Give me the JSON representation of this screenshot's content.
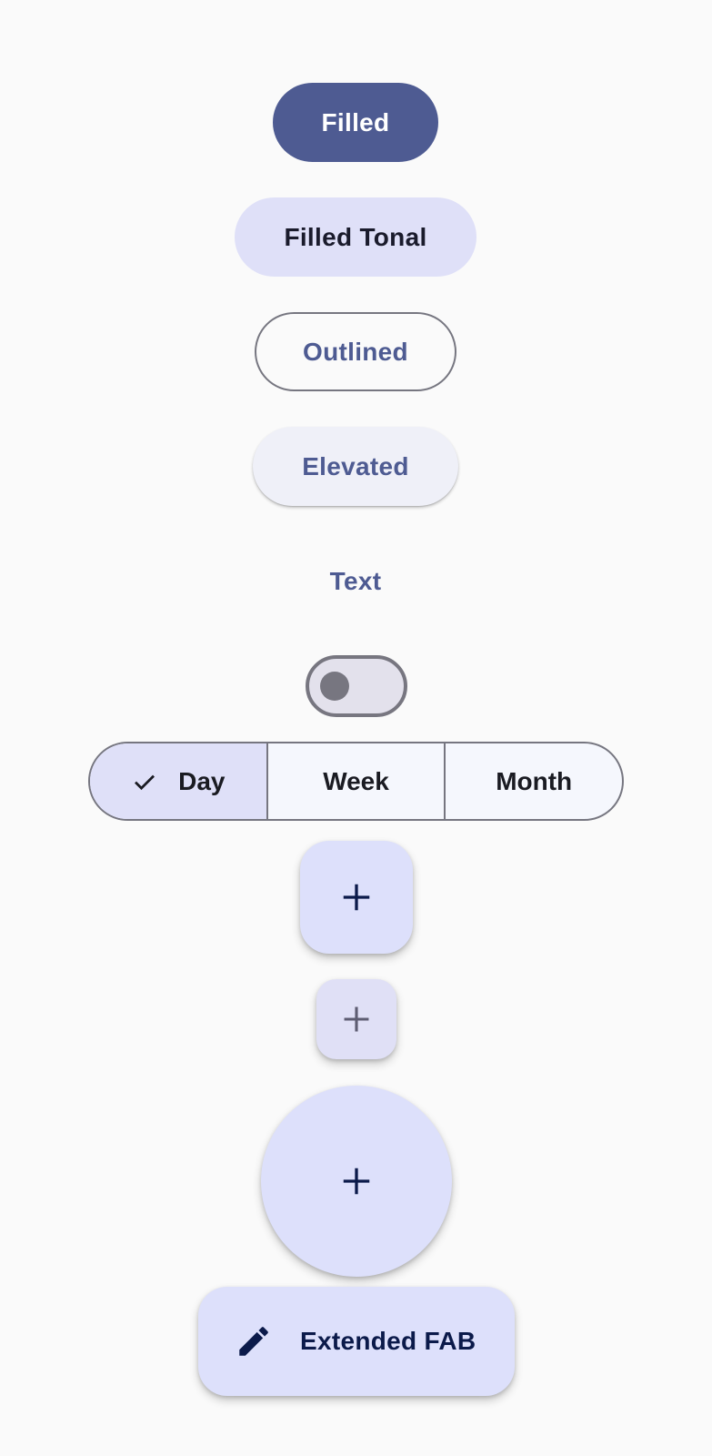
{
  "buttons": {
    "filled": "Filled",
    "filled_tonal": "Filled Tonal",
    "outlined": "Outlined",
    "elevated": "Elevated",
    "text": "Text"
  },
  "switch": {
    "checked": false
  },
  "segmented": {
    "options": [
      {
        "label": "Day",
        "selected": true,
        "icon": "check-icon"
      },
      {
        "label": "Week",
        "selected": false
      },
      {
        "label": "Month",
        "selected": false
      }
    ]
  },
  "fabs": {
    "regular_icon": "add-icon",
    "small_icon": "add-icon",
    "large_icon": "add-icon",
    "extended": {
      "icon": "edit-icon",
      "label": "Extended FAB"
    }
  },
  "colors": {
    "primary": "#4e5b92",
    "on_primary": "#ffffff",
    "secondary_container": "#dfe0f8",
    "outline": "#767680",
    "background": "#fafafa",
    "fab_container": "#dde0fb",
    "on_fab": "#0b1a4a"
  }
}
